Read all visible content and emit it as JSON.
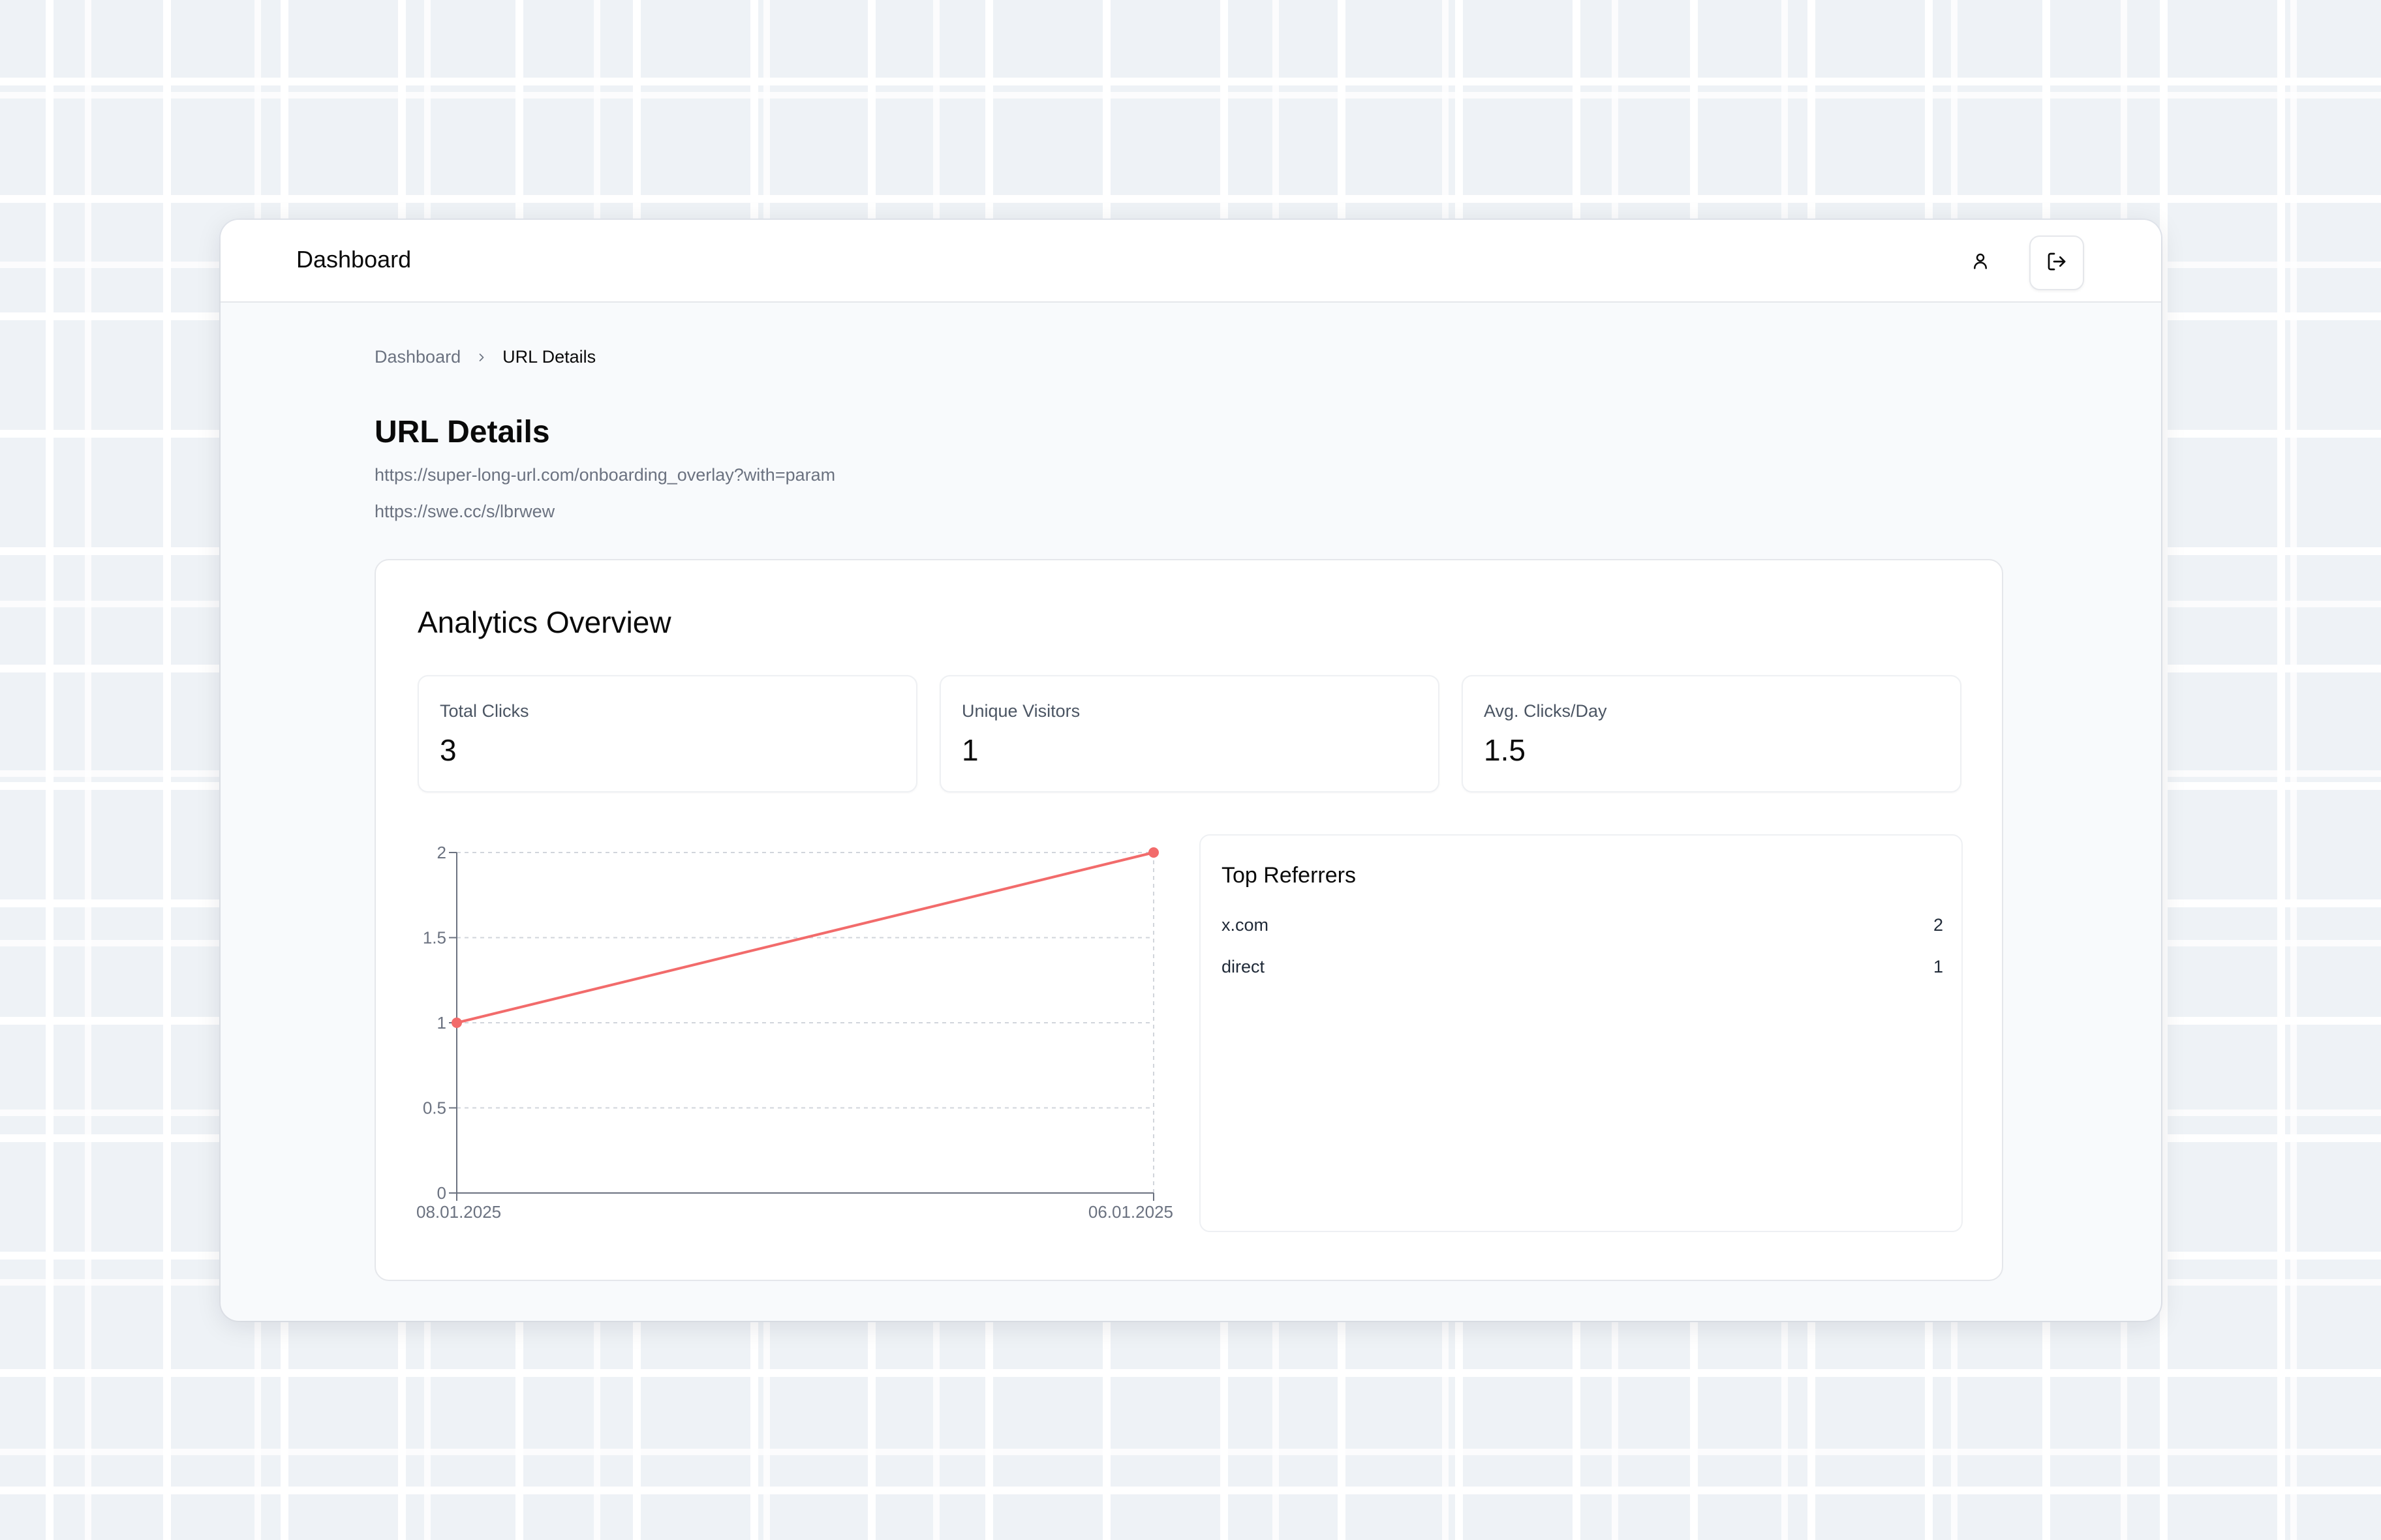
{
  "header": {
    "title": "Dashboard",
    "user_icon": "user-icon",
    "logout_icon": "logout-icon"
  },
  "breadcrumb": {
    "parent": "Dashboard",
    "current": "URL Details"
  },
  "page": {
    "title": "URL Details",
    "long_url": "https://super-long-url.com/onboarding_overlay?with=param",
    "short_url": "https://swe.cc/s/lbrwew"
  },
  "analytics": {
    "title": "Analytics Overview",
    "stats": [
      {
        "label": "Total Clicks",
        "value": "3"
      },
      {
        "label": "Unique Visitors",
        "value": "1"
      },
      {
        "label": "Avg. Clicks/Day",
        "value": "1.5"
      }
    ]
  },
  "chart_data": {
    "type": "line",
    "x": [
      "08.01.2025",
      "06.01.2025"
    ],
    "values": [
      1,
      2
    ],
    "yticks": [
      "0",
      "0.5",
      "1",
      "1.5",
      "2"
    ],
    "ylim": [
      0,
      2
    ],
    "grid": true,
    "line_color": "#f26b6b",
    "title": "",
    "xlabel": "",
    "ylabel": ""
  },
  "referrers": {
    "title": "Top Referrers",
    "items": [
      {
        "name": "x.com",
        "count": "2"
      },
      {
        "name": "direct",
        "count": "1"
      }
    ]
  }
}
